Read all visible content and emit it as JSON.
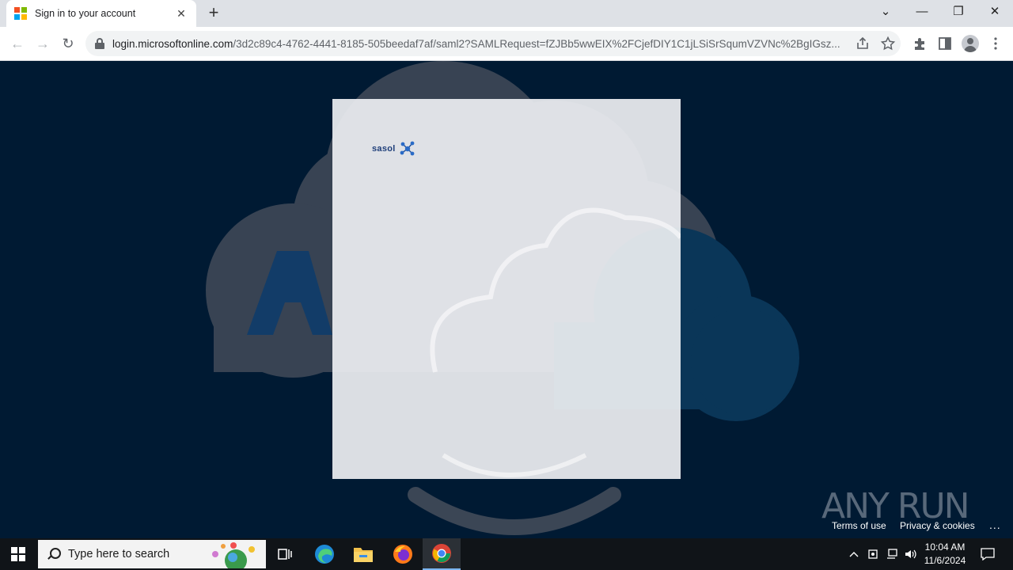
{
  "browser": {
    "tab": {
      "title": "Sign in to your account",
      "close": "✕"
    },
    "new_tab": "+",
    "window_controls": {
      "tab_search": "⌄",
      "minimize": "—",
      "restore": "❐",
      "close": "✕"
    },
    "url_host": "login.microsoftonline.com",
    "url_path": "/3d2c89c4-4762-4441-8185-505beedaf7af/saml2?SAMLRequest=fZJBb5wwEIX%2FCjefDIY1C1jLSiSrSqumVZVNc%2BgIGsz...",
    "nav": {
      "back": "←",
      "forward": "→",
      "reload": "↻"
    }
  },
  "page": {
    "logo_text": "sasol",
    "watermark": "ANY RUN",
    "footer": {
      "terms": "Terms of use",
      "privacy": "Privacy & cookies",
      "more": "..."
    }
  },
  "taskbar": {
    "search_placeholder": "Type here to search",
    "time": "10:04 AM",
    "date": "11/6/2024"
  },
  "colors": {
    "page_bg": "#001a33",
    "ms_red": "#f25022",
    "ms_green": "#7fba00",
    "ms_blue": "#00a4ef",
    "ms_yellow": "#ffb900"
  }
}
